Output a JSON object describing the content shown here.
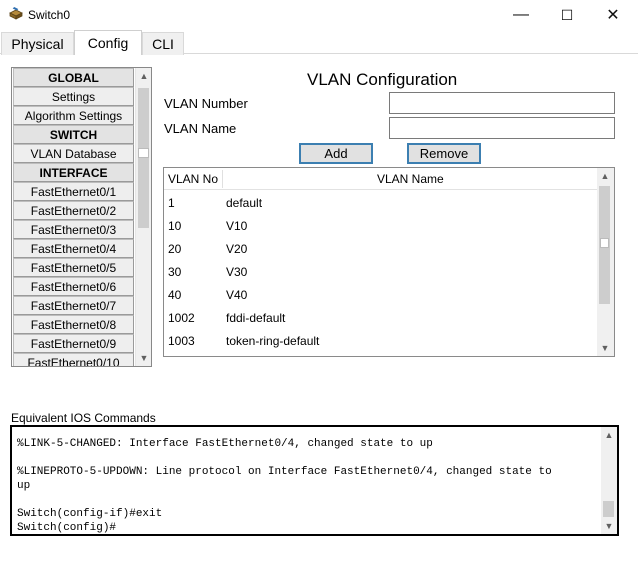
{
  "window": {
    "title": "Switch0",
    "icon": "switch-device-icon",
    "minimize_glyph": "—",
    "maximize_glyph": "☐",
    "close_glyph": "✕"
  },
  "tabs": [
    {
      "label": "Physical",
      "active": false
    },
    {
      "label": "Config",
      "active": true
    },
    {
      "label": "CLI",
      "active": false
    }
  ],
  "nav": {
    "items": [
      {
        "label": "GLOBAL",
        "header": true
      },
      {
        "label": "Settings",
        "header": false
      },
      {
        "label": "Algorithm Settings",
        "header": false
      },
      {
        "label": "SWITCH",
        "header": true
      },
      {
        "label": "VLAN Database",
        "header": false
      },
      {
        "label": "INTERFACE",
        "header": true
      },
      {
        "label": "FastEthernet0/1",
        "header": false
      },
      {
        "label": "FastEthernet0/2",
        "header": false
      },
      {
        "label": "FastEthernet0/3",
        "header": false
      },
      {
        "label": "FastEthernet0/4",
        "header": false
      },
      {
        "label": "FastEthernet0/5",
        "header": false
      },
      {
        "label": "FastEthernet0/6",
        "header": false
      },
      {
        "label": "FastEthernet0/7",
        "header": false
      },
      {
        "label": "FastEthernet0/8",
        "header": false
      },
      {
        "label": "FastEthernet0/9",
        "header": false
      },
      {
        "label": "FastEthernet0/10",
        "header": false
      }
    ]
  },
  "vlan_config": {
    "title": "VLAN Configuration",
    "number_label": "VLAN Number",
    "number_value": "",
    "name_label": "VLAN Name",
    "name_value": "",
    "add_label": "Add",
    "remove_label": "Remove",
    "table": {
      "headers": [
        "VLAN No",
        "VLAN Name"
      ],
      "rows": [
        {
          "no": "1",
          "name": "default"
        },
        {
          "no": "10",
          "name": "V10"
        },
        {
          "no": "20",
          "name": "V20"
        },
        {
          "no": "30",
          "name": "V30"
        },
        {
          "no": "40",
          "name": "V40"
        },
        {
          "no": "1002",
          "name": "fddi-default"
        },
        {
          "no": "1003",
          "name": "token-ring-default"
        }
      ]
    }
  },
  "ios": {
    "label": "Equivalent IOS Commands",
    "lines": [
      "%LINK-5-CHANGED: Interface FastEthernet0/4, changed state to up",
      "",
      "%LINEPROTO-5-UPDOWN: Line protocol on Interface FastEthernet0/4, changed state to",
      "up",
      "",
      "Switch(config-if)#exit",
      "Switch(config)#"
    ]
  }
}
